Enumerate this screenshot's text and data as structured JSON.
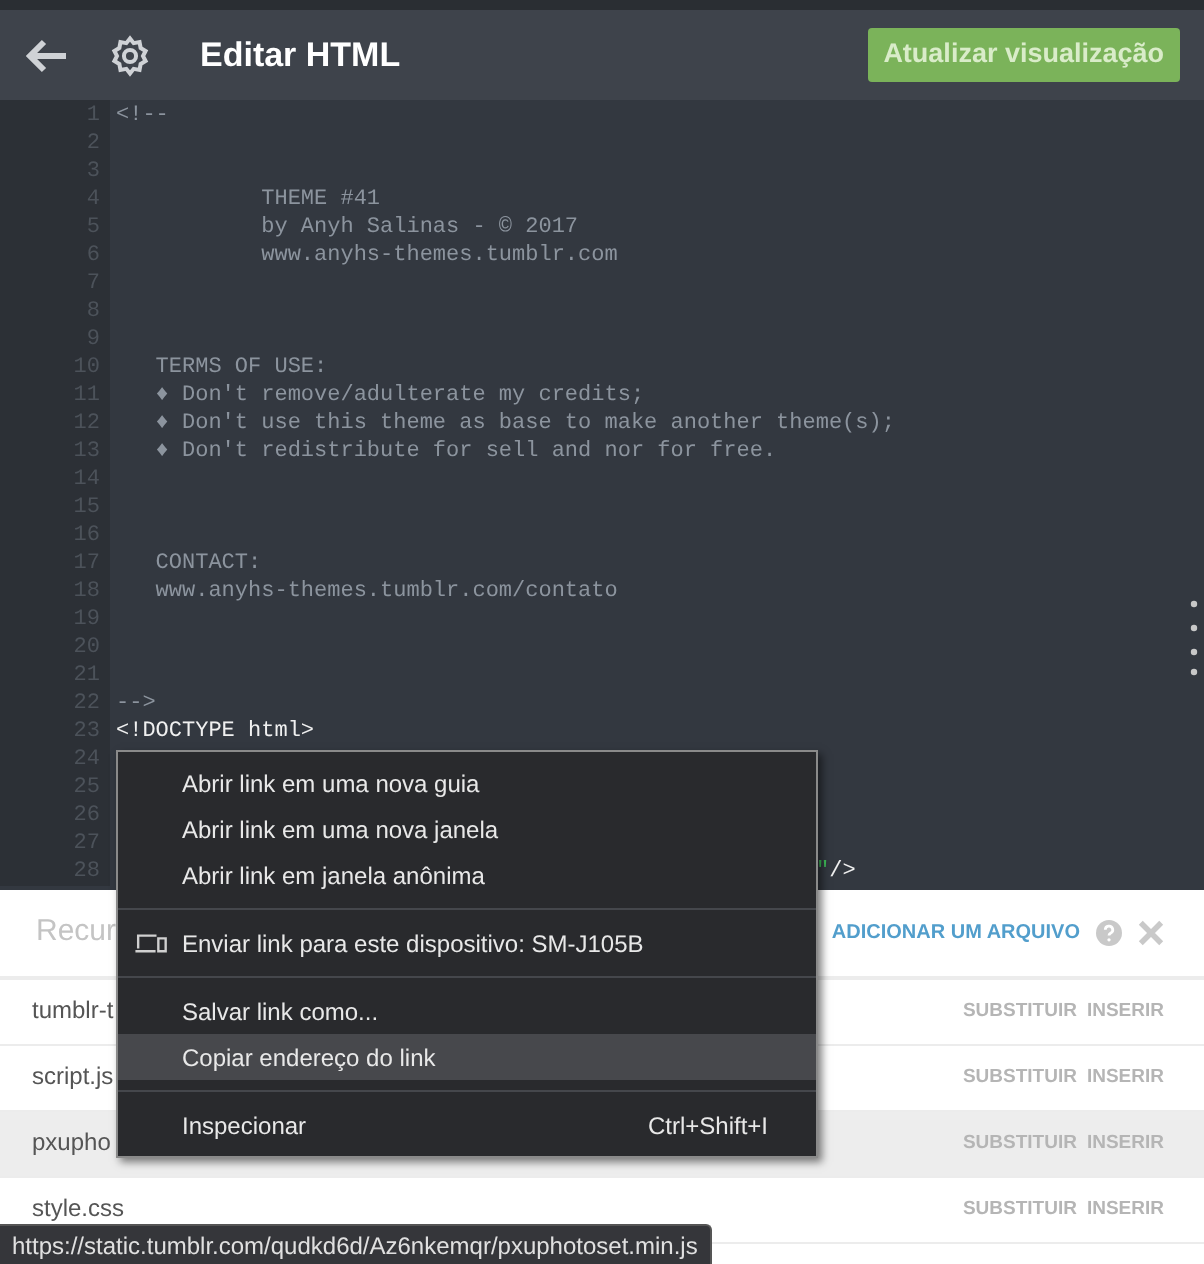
{
  "header": {
    "title": "Editar HTML",
    "update_button": "Atualizar visualização"
  },
  "editor": {
    "lines": [
      {
        "number": "1",
        "text": "<!--",
        "kind": "comment"
      },
      {
        "number": "2"
      },
      {
        "number": "3"
      },
      {
        "number": "4",
        "text": "           THEME #41",
        "kind": "comment"
      },
      {
        "number": "5",
        "text": "           by Anyh Salinas - © 2017",
        "kind": "comment"
      },
      {
        "number": "6",
        "text": "           www.anyhs-themes.tumblr.com",
        "kind": "comment"
      },
      {
        "number": "7"
      },
      {
        "number": "8"
      },
      {
        "number": "9"
      },
      {
        "number": "10",
        "text": "   TERMS OF USE:",
        "kind": "comment"
      },
      {
        "number": "11",
        "text": "   ♦ Don't remove/adulterate my credits;",
        "kind": "comment"
      },
      {
        "number": "12",
        "text": "   ♦ Don't use this theme as base to make another theme(s);",
        "kind": "comment"
      },
      {
        "number": "13",
        "text": "   ♦ Don't redistribute for sell and nor for free.",
        "kind": "comment"
      },
      {
        "number": "14"
      },
      {
        "number": "15"
      },
      {
        "number": "16"
      },
      {
        "number": "17",
        "text": "   CONTACT:",
        "kind": "comment"
      },
      {
        "number": "18",
        "text": "   www.anyhs-themes.tumblr.com/contato",
        "kind": "comment"
      },
      {
        "number": "19"
      },
      {
        "number": "20"
      },
      {
        "number": "21"
      },
      {
        "number": "22",
        "text": "-->",
        "kind": "comment"
      },
      {
        "number": "23",
        "text": "<!DOCTYPE html>",
        "kind": "tag"
      },
      {
        "number": "24"
      },
      {
        "number": "25"
      },
      {
        "number": "26"
      },
      {
        "number": "27"
      },
      {
        "number": "28",
        "tail_quote": "\"",
        "tail": "/>"
      }
    ]
  },
  "resources": {
    "title": "Recur",
    "add_link": "ADICIONAR UM ARQUIVO",
    "rows": [
      {
        "name": "tumblr-t",
        "replace": "SUBSTITUIR",
        "insert": "INSERIR",
        "hovered": false
      },
      {
        "name": "script.js",
        "replace": "SUBSTITUIR",
        "insert": "INSERIR",
        "hovered": false
      },
      {
        "name": "pxupho",
        "replace": "SUBSTITUIR",
        "insert": "INSERIR",
        "hovered": true
      },
      {
        "name": "style.css",
        "replace": "SUBSTITUIR",
        "insert": "INSERIR",
        "hovered": false
      }
    ]
  },
  "context_menu": [
    {
      "kind": "item",
      "label": "Abrir link em uma nova guia",
      "selected": false
    },
    {
      "kind": "item",
      "label": "Abrir link em uma nova janela",
      "selected": false
    },
    {
      "kind": "item",
      "label": "Abrir link em janela anônima",
      "selected": false
    },
    {
      "kind": "separator"
    },
    {
      "kind": "device",
      "label": "Enviar link para este dispositivo: SM-J105B",
      "selected": false
    },
    {
      "kind": "separator"
    },
    {
      "kind": "item",
      "label": "Salvar link como...",
      "selected": false
    },
    {
      "kind": "item",
      "label": "Copiar endereço do link",
      "selected": true
    },
    {
      "kind": "separator"
    },
    {
      "kind": "item",
      "label": "Inspecionar",
      "shortcut": "Ctrl+Shift+I",
      "selected": false
    }
  ],
  "status_url": "https://static.tumblr.com/qudkd6d/Az6nkemqr/pxuphotoset.min.js"
}
